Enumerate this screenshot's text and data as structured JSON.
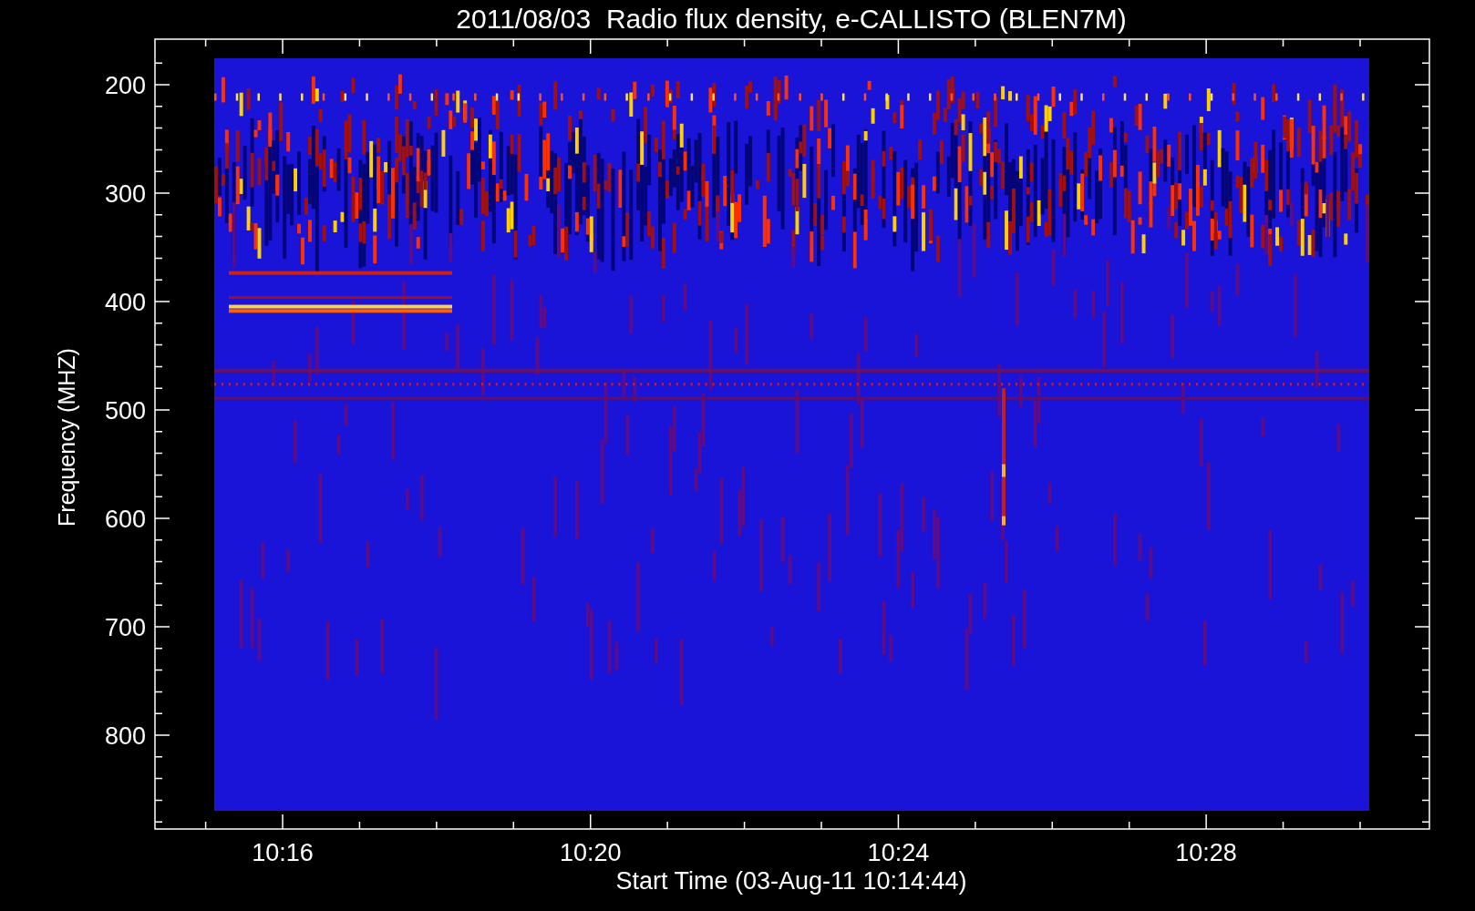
{
  "title": "2011/08/03  Radio flux density, e-CALLISTO (BLEN7M)",
  "y_axis": {
    "label": "Frequency (MHZ)",
    "ticks": [
      "200",
      "300",
      "400",
      "500",
      "600",
      "700",
      "800"
    ]
  },
  "x_axis": {
    "label": "Start Time (03-Aug-11 10:14:44)",
    "ticks": [
      "10:16",
      "10:20",
      "10:24",
      "10:28"
    ]
  }
}
